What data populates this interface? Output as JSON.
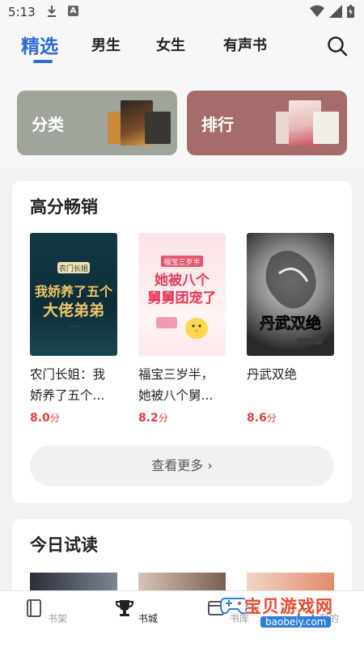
{
  "status": {
    "time": "5:13",
    "notif_icon": "download-icon",
    "notif_app": "A"
  },
  "nav": {
    "tabs": [
      {
        "label": "精选",
        "active": true
      },
      {
        "label": "男生",
        "active": false
      },
      {
        "label": "女生",
        "active": false
      },
      {
        "label": "有声书",
        "active": false
      }
    ],
    "search_icon": "search-icon",
    "accent": "#2a6bd8"
  },
  "categories": [
    {
      "label": "分类",
      "color": "#9fa59b"
    },
    {
      "label": "排行",
      "color": "#a56c6b"
    }
  ],
  "bestsellers": {
    "title": "高分畅销",
    "books": [
      {
        "title": "农门长姐：我娇养了五个...",
        "cover_text": "我娇养了五个大佬弟弟",
        "cover_tag": "农门长姐",
        "score": "8.0",
        "unit": "分"
      },
      {
        "title": "福宝三岁半，她被八个舅...",
        "cover_text": "她被八个舅舅团宠了",
        "cover_tag": "福宝三岁半",
        "score": "8.2",
        "unit": "分"
      },
      {
        "title": "丹武双绝",
        "cover_text": "丹武双绝",
        "cover_tag": "",
        "score": "8.6",
        "unit": "分"
      }
    ],
    "more_label": "查看更多",
    "score_color": "#e23d3d"
  },
  "trial": {
    "title": "今日试读"
  },
  "bottom_nav": [
    {
      "label": "书架",
      "icon": "bookshelf-icon",
      "active": false
    },
    {
      "label": "书城",
      "icon": "trophy-icon",
      "active": true
    },
    {
      "label": "书库",
      "icon": "library-icon",
      "active": false
    },
    {
      "label": "我的",
      "icon": "profile-icon",
      "active": false
    }
  ],
  "watermark": {
    "text": "宝贝游戏网",
    "url": "baobeiy.com"
  }
}
